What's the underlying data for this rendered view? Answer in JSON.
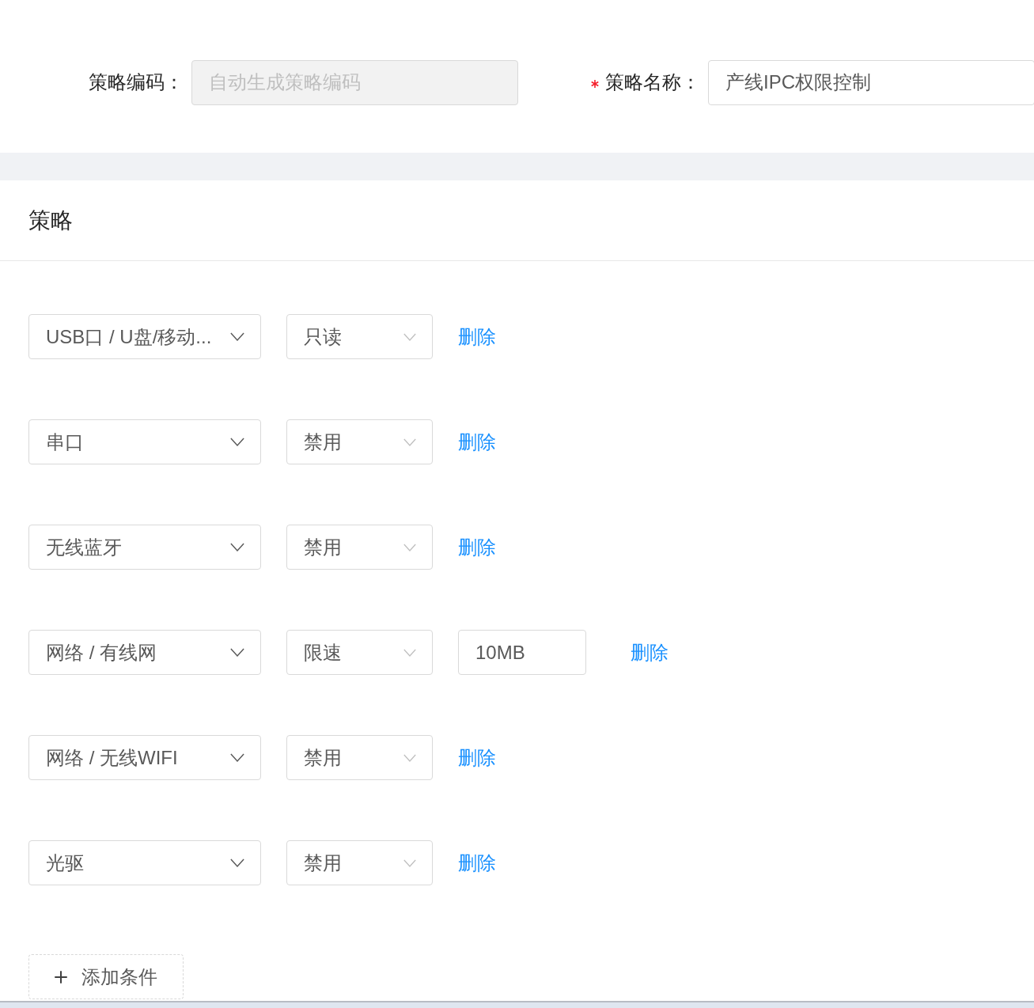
{
  "form_fields": [
    {
      "label": "策略编码：",
      "placeholder": "自动生成策略编码",
      "disabled": true,
      "required": false
    },
    {
      "label": "策略名称：",
      "value": "产线IPC权限控制",
      "disabled": false,
      "required": true
    }
  ],
  "section": {
    "title": "策略"
  },
  "rules": [
    {
      "target": "USB口 / U盘/移动...",
      "action": "只读",
      "delete": "删除"
    },
    {
      "target": "串口",
      "action": "禁用",
      "delete": "删除"
    },
    {
      "target": "无线蓝牙",
      "action": "禁用",
      "delete": "删除"
    },
    {
      "target": "网络 / 有线网",
      "action": "限速",
      "limit": "10MB",
      "delete": "删除"
    },
    {
      "target": "网络 / 无线WIFI",
      "action": "禁用",
      "delete": "删除"
    },
    {
      "target": "光驱",
      "action": "禁用",
      "delete": "删除"
    }
  ],
  "add_button": "添加条件"
}
